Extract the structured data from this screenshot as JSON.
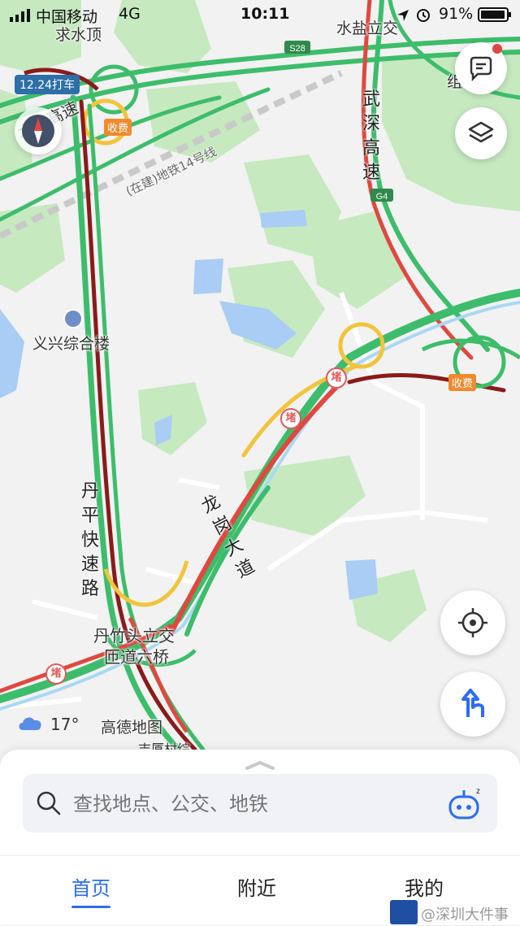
{
  "status_bar": {
    "carrier": "中国移动",
    "network": "4G",
    "time": "10:11",
    "battery_percent": "91%"
  },
  "map": {
    "labels": {
      "qiushuiding": "求水顶",
      "shuiyan_interchange": "水盐立交",
      "wushen_highway": "武深高速",
      "yixing_building": "义兴综合楼",
      "danping_expressway": "丹平快速路",
      "longgang_avenue": "龙岗大道",
      "danzhutou_interchange_1": "丹竹头立交",
      "danzhutou_interchange_2": "匝道六桥",
      "gaode_map": "高德地图",
      "metro_line": "(在建)地铁14号线",
      "partial_highway": "水官高速",
      "partial_top_right": "组",
      "partial_bottom": "吉厦村综"
    },
    "shields": {
      "s28": "S28",
      "g4": "G4"
    },
    "toll_label": "收费",
    "jam_label": "堵",
    "taxi_badge": "12.24打车",
    "weather": {
      "temperature": "17°",
      "icon": "cloud-icon"
    }
  },
  "search": {
    "placeholder": "查找地点、公交、地铁"
  },
  "tabs": [
    {
      "label": "首页",
      "active": true
    },
    {
      "label": "附近",
      "active": false
    },
    {
      "label": "我的",
      "active": false
    }
  ],
  "watermark": "@深圳大件事",
  "colors": {
    "accent": "#2a6df4",
    "congestion_red": "#e0483f",
    "slow_yellow": "#f2c43c",
    "smooth_green": "#3dbd6b",
    "severe_darkred": "#8b1a1a",
    "park_green": "#c6e9c0",
    "water_blue": "#a9cdf4"
  }
}
